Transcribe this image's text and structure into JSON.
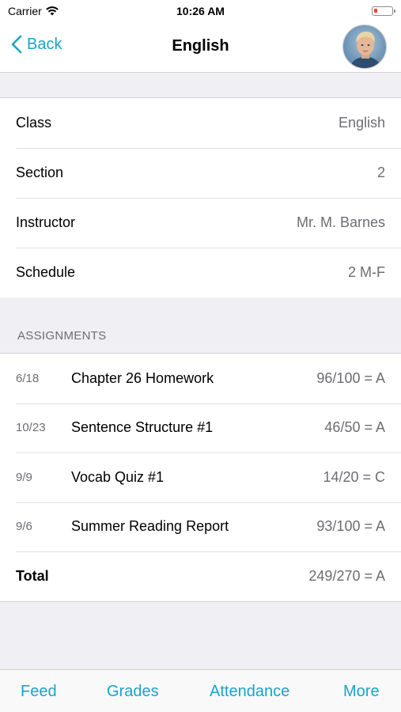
{
  "status_bar": {
    "carrier": "Carrier",
    "time": "10:26 AM"
  },
  "nav": {
    "back_label": "Back",
    "title": "English"
  },
  "info": [
    {
      "label": "Class",
      "value": "English"
    },
    {
      "label": "Section",
      "value": "2"
    },
    {
      "label": "Instructor",
      "value": "Mr. M. Barnes"
    },
    {
      "label": "Schedule",
      "value": "2 M-F"
    }
  ],
  "assignments_header": "ASSIGNMENTS",
  "assignments": [
    {
      "date": "6/18",
      "name": "Chapter 26 Homework",
      "score": "96/100 = A"
    },
    {
      "date": "10/23",
      "name": "Sentence Structure #1",
      "score": "46/50 = A"
    },
    {
      "date": "9/9",
      "name": "Vocab Quiz #1",
      "score": "14/20 = C"
    },
    {
      "date": "9/6",
      "name": "Summer Reading Report",
      "score": "93/100 = A"
    }
  ],
  "total": {
    "label": "Total",
    "score": "249/270 = A"
  },
  "tabs": [
    {
      "label": "Feed"
    },
    {
      "label": "Grades"
    },
    {
      "label": "Attendance"
    },
    {
      "label": "More"
    }
  ],
  "colors": {
    "accent": "#1aa3c9",
    "background": "#efeff4",
    "secondary_text": "#6d6d72",
    "battery_low": "#ff3b30"
  }
}
